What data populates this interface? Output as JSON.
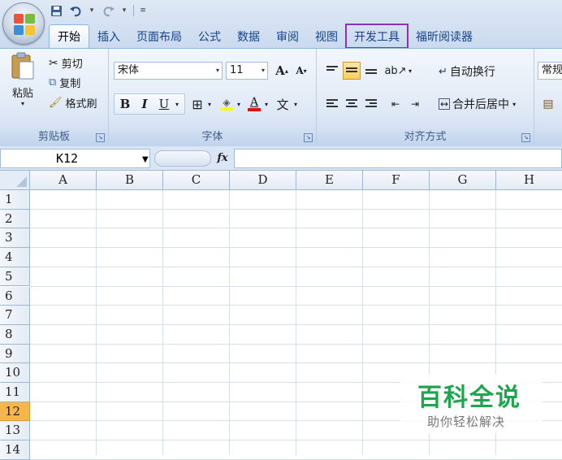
{
  "title_bar": {
    "qat": {
      "save_icon": "save-icon",
      "undo_icon": "undo-icon",
      "redo_icon": "redo-icon",
      "customize_icon": "customize-qat-icon"
    }
  },
  "tabs": [
    {
      "label": "开始",
      "active": true
    },
    {
      "label": "插入"
    },
    {
      "label": "页面布局"
    },
    {
      "label": "公式"
    },
    {
      "label": "数据"
    },
    {
      "label": "审阅"
    },
    {
      "label": "视图"
    },
    {
      "label": "开发工具",
      "highlighted": true,
      "highlight_color": "#8b32b6"
    },
    {
      "label": "福昕阅读器"
    }
  ],
  "ribbon": {
    "clipboard": {
      "label": "剪贴板",
      "paste": "粘贴",
      "cut": "剪切",
      "copy": "复制",
      "format_painter": "格式刷"
    },
    "font": {
      "label": "字体",
      "font_name": "宋体",
      "font_size": "11",
      "bold": "B",
      "italic": "I",
      "underline": "U",
      "grow_font": "A",
      "shrink_font": "A",
      "font_color_letter": "A",
      "phonetic": "文"
    },
    "alignment": {
      "label": "对齐方式",
      "wrap_text": "自动换行",
      "merge_center": "合并后居中"
    },
    "number": {
      "format": "常规"
    }
  },
  "formula_bar": {
    "name_box": "K12",
    "fx": "fx",
    "formula": ""
  },
  "grid": {
    "columns": [
      "A",
      "B",
      "C",
      "D",
      "E",
      "F",
      "G",
      "H"
    ],
    "rows": [
      "1",
      "2",
      "3",
      "4",
      "5",
      "6",
      "7",
      "8",
      "9",
      "10",
      "11",
      "12",
      "13",
      "14"
    ],
    "selected_row": "12",
    "selected_color": "#f7b54a"
  },
  "watermark": {
    "title": "百科全说",
    "subtitle": "助你轻松解决"
  }
}
